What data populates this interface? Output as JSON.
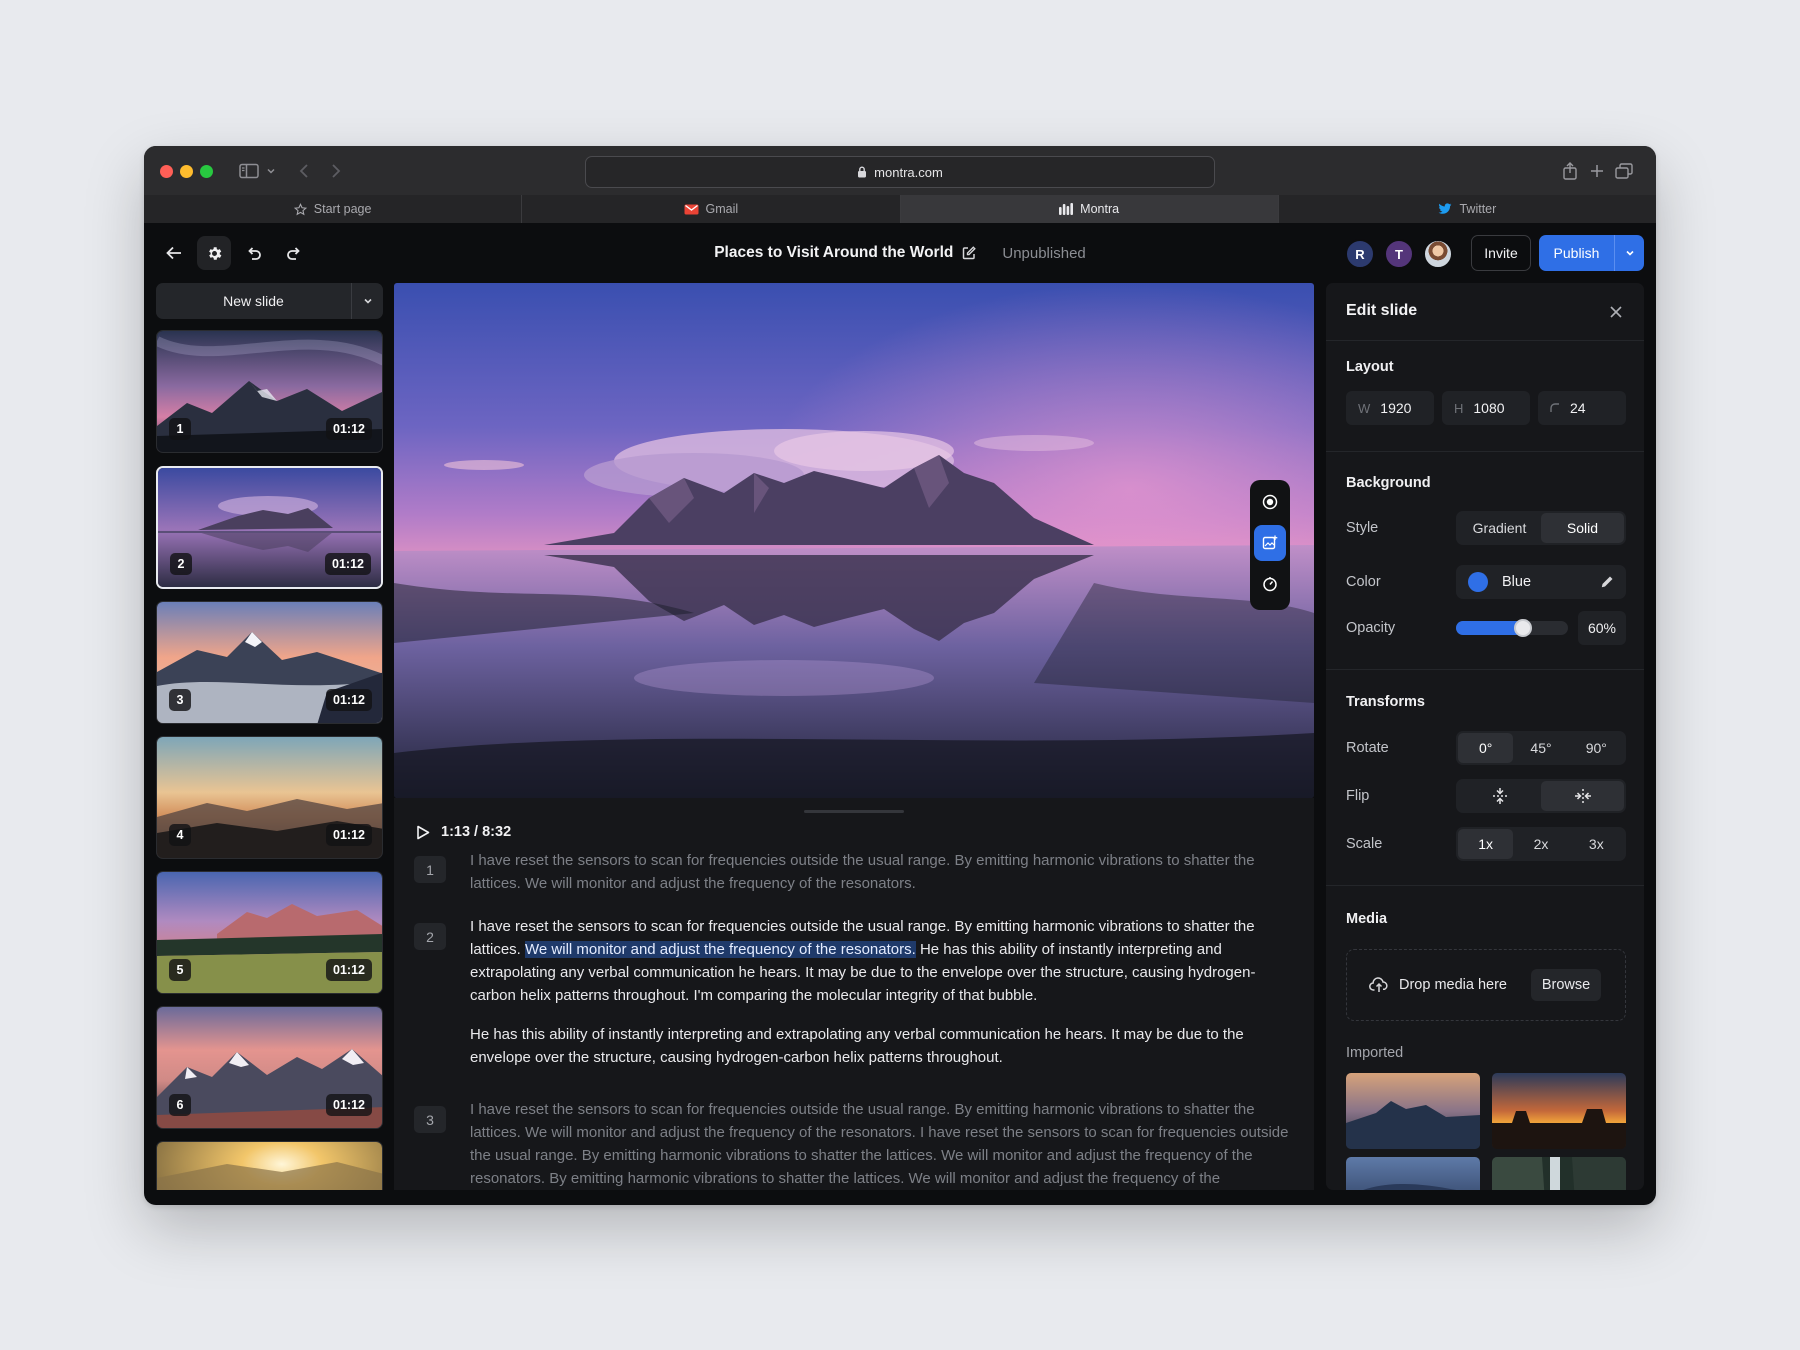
{
  "browser": {
    "url": "montra.com",
    "tabs": [
      {
        "label": "Start page",
        "icon": "star-icon"
      },
      {
        "label": "Gmail",
        "icon": "gmail-icon"
      },
      {
        "label": "Montra",
        "icon": "montra-logo-icon",
        "active": true
      },
      {
        "label": "Twitter",
        "icon": "twitter-icon"
      }
    ]
  },
  "header": {
    "title": "Places to Visit Around the World",
    "status": "Unpublished",
    "avatars": [
      "R",
      "T"
    ],
    "invite_label": "Invite",
    "publish_label": "Publish"
  },
  "sidebar": {
    "new_slide_label": "New slide",
    "slides": [
      {
        "number": "1",
        "duration": "01:12"
      },
      {
        "number": "2",
        "duration": "01:12",
        "selected": true
      },
      {
        "number": "3",
        "duration": "01:12"
      },
      {
        "number": "4",
        "duration": "01:12"
      },
      {
        "number": "5",
        "duration": "01:12"
      },
      {
        "number": "6",
        "duration": "01:12"
      }
    ]
  },
  "player": {
    "time": "1:13 / 8:32"
  },
  "script": {
    "p1_num": "1",
    "p1": "I have reset the sensors to scan for frequencies outside the usual range. By emitting harmonic vibrations to shatter the lattices. We will monitor and adjust the frequency of the resonators.",
    "p2_num": "2",
    "p2_before": "I have reset the sensors to scan for frequencies outside the usual range. By emitting harmonic vibrations to shatter the lattices. ",
    "p2_highlight": "We will monitor and adjust the frequency of the resonators.",
    "p2_after": " He has this ability of instantly interpreting and extrapolating any verbal communication he hears. It may be due to the envelope over the structure, causing hydrogen-carbon helix patterns throughout. I'm comparing the molecular integrity of that bubble.",
    "p2b": "He has this ability of instantly interpreting and extrapolating any verbal communication he hears. It may be due to the envelope over the structure, causing hydrogen-carbon helix patterns throughout.",
    "p3_num": "3",
    "p3": "I have reset the sensors to scan for frequencies outside the usual range. By emitting harmonic vibrations to shatter the lattices. We will monitor and adjust the frequency of the resonators. I have reset the sensors to scan for frequencies outside the usual range. By emitting harmonic vibrations to shatter the lattices. We will monitor and adjust the frequency of the resonators. By emitting harmonic vibrations to shatter the lattices. We will monitor and adjust the frequency of the resonators."
  },
  "panel": {
    "title": "Edit slide",
    "layout": {
      "title": "Layout",
      "w_label": "W",
      "w": "1920",
      "h_label": "H",
      "h": "1080",
      "radius": "24"
    },
    "background": {
      "title": "Background",
      "style_label": "Style",
      "style_options": [
        "Gradient",
        "Solid"
      ],
      "style_selected": "Solid",
      "color_label": "Color",
      "color_name": "Blue",
      "color_hex": "#2f6fe6",
      "opacity_label": "Opacity",
      "opacity": 0.6,
      "opacity_text": "60%"
    },
    "transforms": {
      "title": "Transforms",
      "rotate_label": "Rotate",
      "rotate_options": [
        "0°",
        "45°",
        "90°"
      ],
      "rotate_selected": "0°",
      "flip_label": "Flip",
      "flip_options": [
        "flip-vertical-icon",
        "flip-horizontal-icon"
      ],
      "flip_selected": "flip-horizontal-icon",
      "scale_label": "Scale",
      "scale_options": [
        "1x",
        "2x",
        "3x"
      ],
      "scale_selected": "1x"
    },
    "media": {
      "title": "Media",
      "drop_label": "Drop media here",
      "browse_label": "Browse",
      "imported_label": "Imported"
    }
  },
  "colors": {
    "accent": "#2f6fe6",
    "app_bg": "#0c0d0f",
    "panel_bg": "#16171a"
  }
}
